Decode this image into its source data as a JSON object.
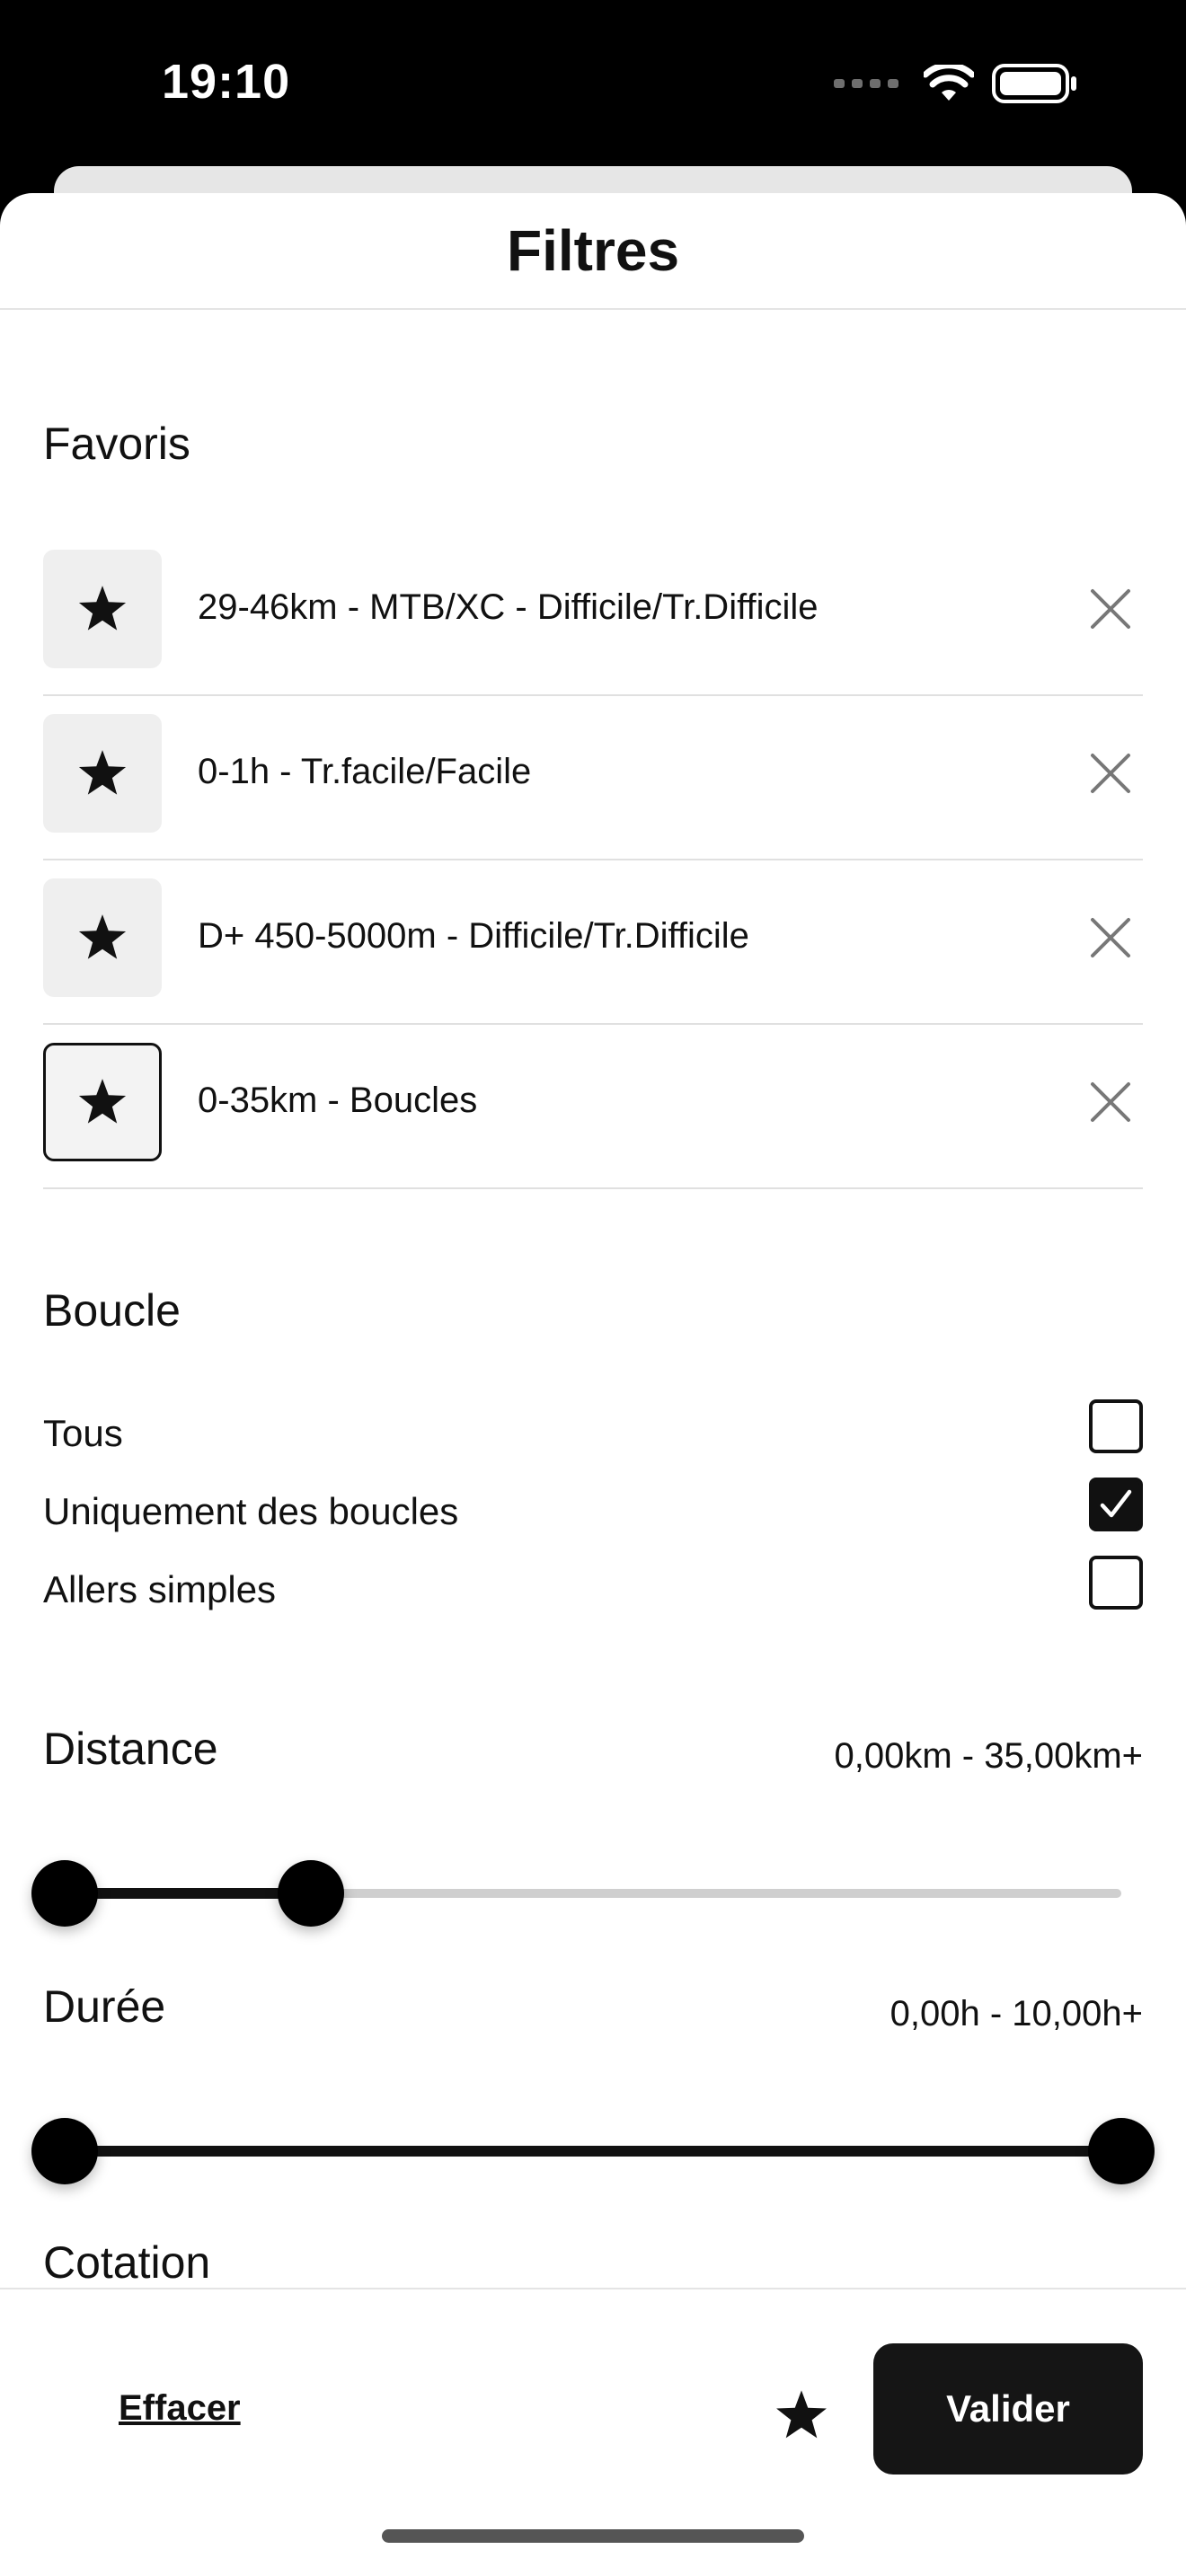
{
  "status_bar": {
    "time": "19:10"
  },
  "header": {
    "title": "Filtres"
  },
  "favorites": {
    "title": "Favoris",
    "items": [
      {
        "label": "29-46km - MTB/XC - Difficile/Tr.Difficile",
        "selected": false
      },
      {
        "label": "0-1h - Tr.facile/Facile",
        "selected": false
      },
      {
        "label": "D+ 450-5000m - Difficile/Tr.Difficile",
        "selected": false
      },
      {
        "label": "0-35km - Boucles",
        "selected": true
      }
    ]
  },
  "loop": {
    "title": "Boucle",
    "options": [
      {
        "label": "Tous",
        "checked": false
      },
      {
        "label": "Uniquement des boucles",
        "checked": true
      },
      {
        "label": "Allers simples",
        "checked": false
      }
    ]
  },
  "distance": {
    "title": "Distance",
    "range_text": "0,00km - 35,00km+",
    "low_fraction": 0.0,
    "high_fraction": 0.233
  },
  "duration": {
    "title": "Durée",
    "range_text": "0,00h - 10,00h+",
    "low_fraction": 0.0,
    "high_fraction": 1.0
  },
  "rating": {
    "title": "Cotation"
  },
  "footer": {
    "clear_label": "Effacer",
    "validate_label": "Valider"
  },
  "icons": {
    "favorite": "star-icon",
    "remove": "close-icon",
    "check": "checkmark-icon"
  }
}
